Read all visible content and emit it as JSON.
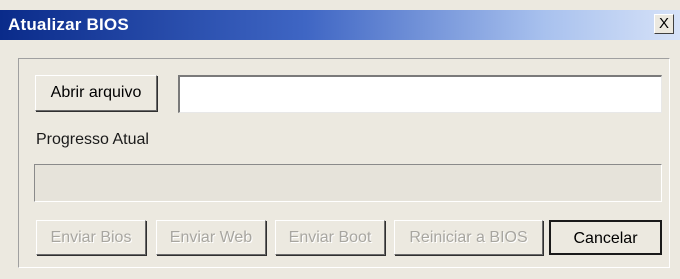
{
  "window": {
    "title": "Atualizar BIOS",
    "close_label": "X"
  },
  "file": {
    "open_label": "Abrir arquivo",
    "path_value": ""
  },
  "progress": {
    "label": "Progresso Atual",
    "value": 0
  },
  "actions": {
    "send_bios": "Enviar Bios",
    "send_web": "Enviar Web",
    "send_boot": "Enviar Boot",
    "restart_bios": "Reiniciar a BIOS",
    "cancel": "Cancelar"
  },
  "colors": {
    "titlebar_start": "#0a2b8a",
    "titlebar_end": "#d6e2f8",
    "window_bg": "#ece9e0",
    "disabled_text": "#a8a6a0"
  }
}
